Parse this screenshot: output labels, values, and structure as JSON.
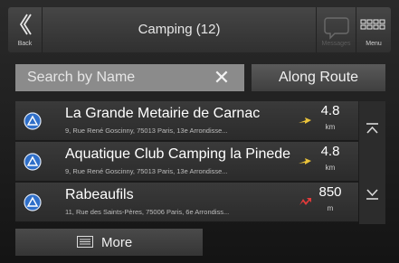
{
  "header": {
    "back_label": "Back",
    "title": "Camping (12)",
    "message_label": "Messages",
    "menu_label": "Menu"
  },
  "search": {
    "placeholder": "Search by Name",
    "clear_glyph": "✕",
    "along_route_label": "Along Route"
  },
  "results": [
    {
      "name": "La Grande Metairie de Carnac",
      "address": "9, Rue René Goscinny, 75013 Paris, 13e Arrondisse...",
      "distance": "4.8",
      "unit": "km",
      "arrow_color": "#e9c23a"
    },
    {
      "name": "Aquatique Club Camping la Pinede",
      "address": "9, Rue René Goscinny, 75013 Paris, 13e Arrondisse...",
      "distance": "4.8",
      "unit": "km",
      "arrow_color": "#e9c23a"
    },
    {
      "name": "Rabeaufils",
      "address": "11, Rue des Saints-Pères, 75006 Paris, 6e Arrondiss...",
      "distance": "850",
      "unit": "m",
      "arrow_color": "#e23b3b"
    }
  ],
  "more_label": "More",
  "colors": {
    "poi_icon": "#2f6fc9",
    "background": "#1c1c1c"
  }
}
